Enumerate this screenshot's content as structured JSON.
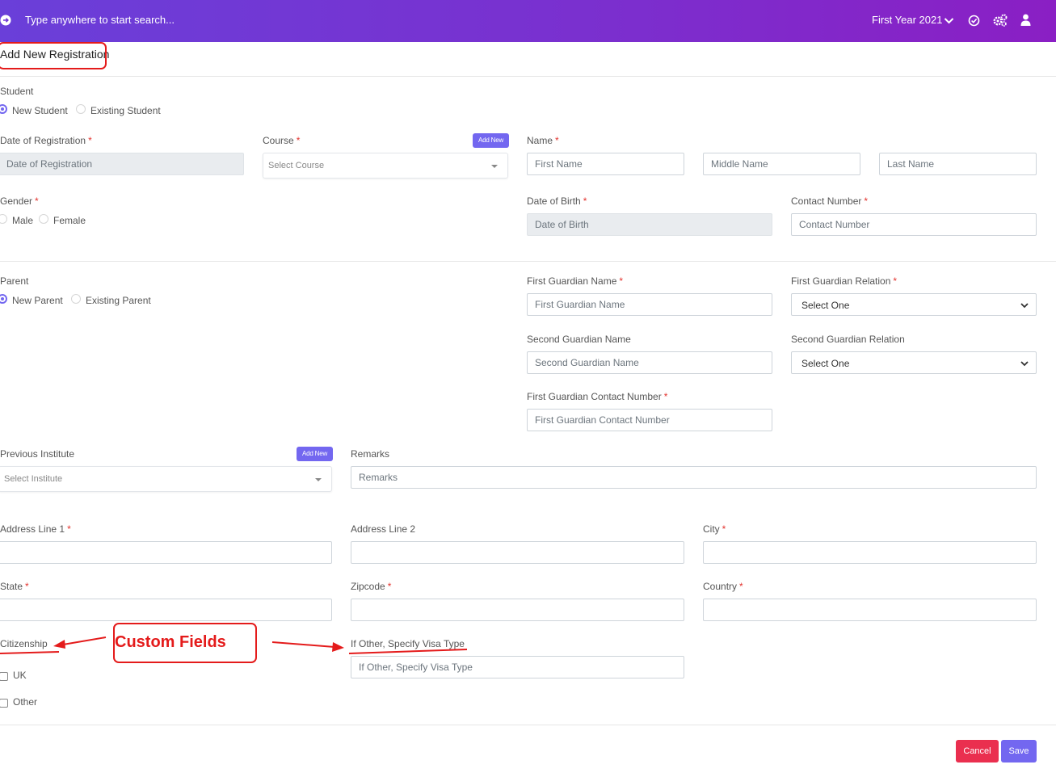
{
  "topbar": {
    "search_placeholder": "Type anywhere to start search...",
    "year_label": "First Year 2021",
    "icons": [
      "arrow-circle-right-icon",
      "chevron-down-icon",
      "check-circle-icon",
      "cogs-icon",
      "user-icon"
    ]
  },
  "page": {
    "title": "Add New Registration"
  },
  "student": {
    "label": "Student",
    "options": [
      "New Student",
      "Existing Student"
    ],
    "selected": "New Student"
  },
  "date_of_registration": {
    "label": "Date of Registration",
    "placeholder": "Date of Registration"
  },
  "course": {
    "label": "Course",
    "add_new": "Add New",
    "placeholder": "Select Course"
  },
  "name": {
    "label": "Name",
    "first_placeholder": "First Name",
    "middle_placeholder": "Middle Name",
    "last_placeholder": "Last Name"
  },
  "gender": {
    "label": "Gender",
    "options": [
      "Male",
      "Female"
    ]
  },
  "date_of_birth": {
    "label": "Date of Birth",
    "placeholder": "Date of Birth"
  },
  "contact_number": {
    "label": "Contact Number",
    "placeholder": "Contact Number"
  },
  "parent": {
    "label": "Parent",
    "options": [
      "New Parent",
      "Existing Parent"
    ],
    "selected": "New Parent"
  },
  "first_guardian_name": {
    "label": "First Guardian Name",
    "placeholder": "First Guardian Name"
  },
  "first_guardian_relation": {
    "label": "First Guardian Relation",
    "value": "Select One"
  },
  "second_guardian_name": {
    "label": "Second Guardian Name",
    "placeholder": "Second Guardian Name"
  },
  "second_guardian_relation": {
    "label": "Second Guardian Relation",
    "value": "Select One"
  },
  "first_guardian_contact": {
    "label": "First Guardian Contact Number",
    "placeholder": "First Guardian Contact Number"
  },
  "previous_institute": {
    "label": "Previous Institute",
    "add_new": "Add New",
    "placeholder": "Select Institute"
  },
  "remarks": {
    "label": "Remarks",
    "placeholder": "Remarks"
  },
  "address_line_1": {
    "label": "Address Line 1"
  },
  "address_line_2": {
    "label": "Address Line 2"
  },
  "city": {
    "label": "City"
  },
  "state": {
    "label": "State"
  },
  "zipcode": {
    "label": "Zipcode"
  },
  "country": {
    "label": "Country"
  },
  "citizenship": {
    "label": "Citizenship",
    "options": [
      "UK",
      "Other"
    ]
  },
  "visa_type": {
    "label": "If Other, Specify Visa Type",
    "placeholder": "If Other, Specify Visa Type"
  },
  "annotation": {
    "text": "Custom Fields",
    "color": "#e41b1b"
  },
  "actions": {
    "cancel": "Cancel",
    "save": "Save"
  },
  "colors": {
    "accent": "#7367f0",
    "danger": "#ea2f4f",
    "required": "#e3342f"
  }
}
